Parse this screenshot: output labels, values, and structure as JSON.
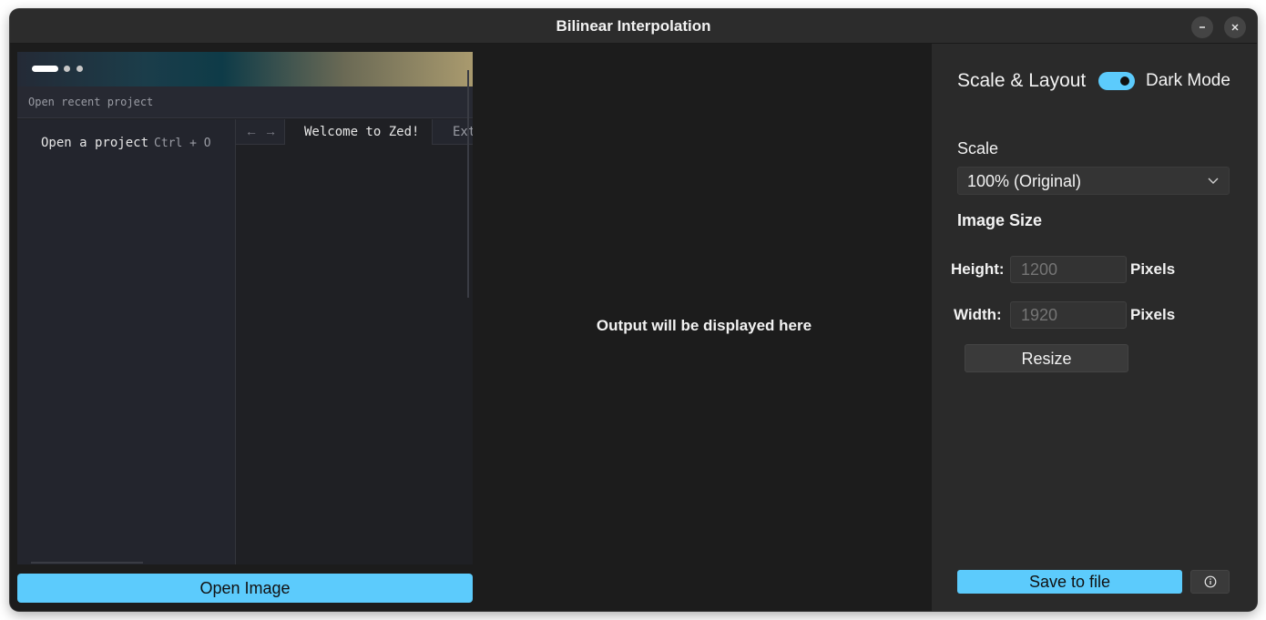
{
  "window": {
    "title": "Bilinear Interpolation",
    "minimize_icon": "minimize-icon",
    "close_icon": "close-icon"
  },
  "input_preview": {
    "command_bar_text": "Open recent project",
    "sidebar_item": "Open a project",
    "sidebar_shortcut": "Ctrl + O",
    "nav_back_icon": "arrow-left-icon",
    "nav_forward_icon": "arrow-right-icon",
    "active_tab": "Welcome to Zed!",
    "next_tab": "Ext"
  },
  "open_image_button": "Open Image",
  "output": {
    "placeholder": "Output will be displayed here"
  },
  "settings": {
    "section_title": "Scale & Layout",
    "dark_mode_label": "Dark Mode",
    "dark_mode_on": true,
    "scale_label": "Scale",
    "scale_value": "100% (Original)",
    "image_size_label": "Image Size",
    "height_label": "Height:",
    "height_placeholder": "1200",
    "height_unit": "Pixels",
    "width_label": "Width:",
    "width_placeholder": "1920",
    "width_unit": "Pixels",
    "resize_button": "Resize",
    "save_button": "Save to file",
    "info_icon": "info-icon"
  },
  "colors": {
    "accent": "#5ccbfc",
    "window_bg": "#1c1c1c",
    "panel_bg": "#2a2a2a",
    "titlebar_bg": "#2c2c2c"
  }
}
